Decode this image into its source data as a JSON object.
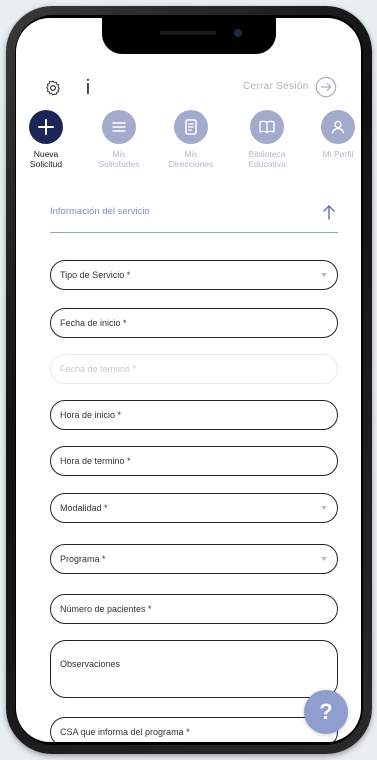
{
  "header": {
    "logout_label": "Cerrar Sesión",
    "info_glyph": "i"
  },
  "nav": {
    "items": [
      {
        "label": "Nueva\nSolicitud",
        "icon": "plus-icon",
        "active": true
      },
      {
        "label": "Mis\nSolicitudes",
        "icon": "list-icon",
        "active": false
      },
      {
        "label": "Mis\nDirecciones",
        "icon": "document-icon",
        "active": false
      },
      {
        "label": "Biblioteca\nEducativa",
        "icon": "book-icon",
        "active": false
      },
      {
        "label": "Mi Perfil",
        "icon": "user-icon",
        "active": false
      }
    ]
  },
  "section": {
    "title": "Información del servicio"
  },
  "form": {
    "fields": [
      {
        "label": "Tipo de Servicio *",
        "type": "select"
      },
      {
        "label": "Fecha de inicio *",
        "type": "input"
      },
      {
        "label": "Fecha de termino *",
        "type": "input",
        "disabled": true
      },
      {
        "label": "Hora de inicio *",
        "type": "input"
      },
      {
        "label": "Hora de termino *",
        "type": "input"
      },
      {
        "label": "Modalidad *",
        "type": "select"
      },
      {
        "label": "Programa *",
        "type": "select"
      },
      {
        "label": "Número de pacientes *",
        "type": "input"
      },
      {
        "label": "Observaciones",
        "type": "textarea"
      },
      {
        "label": "CSA que informa del programa *",
        "type": "input"
      }
    ]
  },
  "help": {
    "glyph": "?"
  },
  "colors": {
    "primary": "#1c2656",
    "inactive": "#a4aacb",
    "section_text": "#8290b8",
    "help": "#8f9dcf"
  }
}
